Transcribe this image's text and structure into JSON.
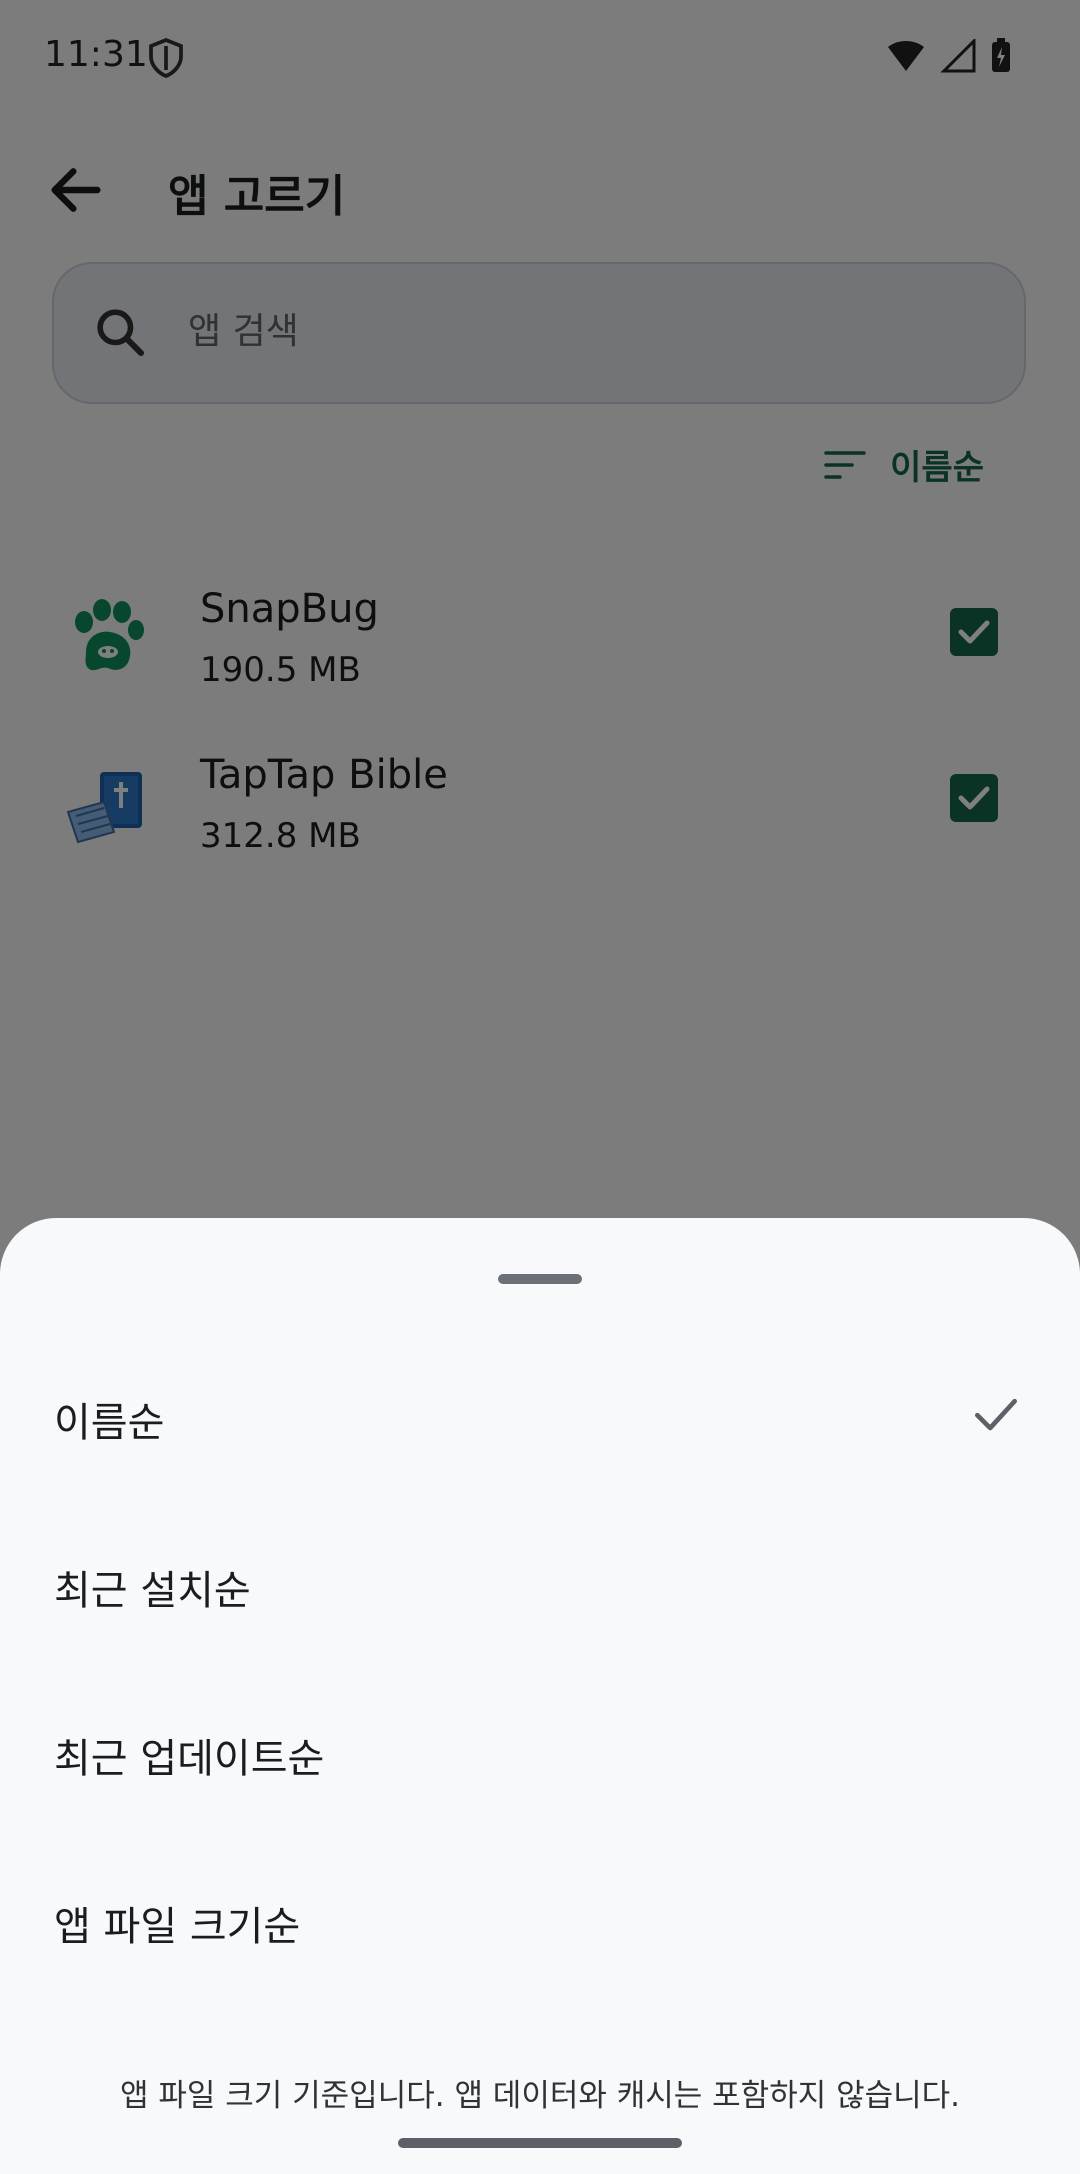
{
  "status_bar": {
    "time": "11:31"
  },
  "header": {
    "title": "앱 고르기",
    "back_icon": "arrow-left-icon"
  },
  "search": {
    "placeholder": "앱 검색"
  },
  "sort": {
    "current_label": "이름순",
    "icon": "sort-icon"
  },
  "apps": [
    {
      "name": "SnapBug",
      "size": "190.5 MB",
      "checked": true,
      "icon": "paw-bug-icon"
    },
    {
      "name": "TapTap Bible",
      "size": "312.8 MB",
      "checked": true,
      "icon": "bible-keyboard-icon"
    }
  ],
  "sheet": {
    "options": [
      {
        "label": "이름순",
        "selected": true
      },
      {
        "label": "최근 설치순",
        "selected": false
      },
      {
        "label": "최근 업데이트순",
        "selected": false
      },
      {
        "label": "앱 파일 크기순",
        "selected": false
      }
    ],
    "footnote": "앱 파일 크기 기준입니다. 앱 데이터와 캐시는 포함하지 않습니다."
  },
  "colors": {
    "accent": "#17664a",
    "sheet_bg": "#f8f9fb",
    "scrim": "rgba(0,0,0,0.5)"
  }
}
